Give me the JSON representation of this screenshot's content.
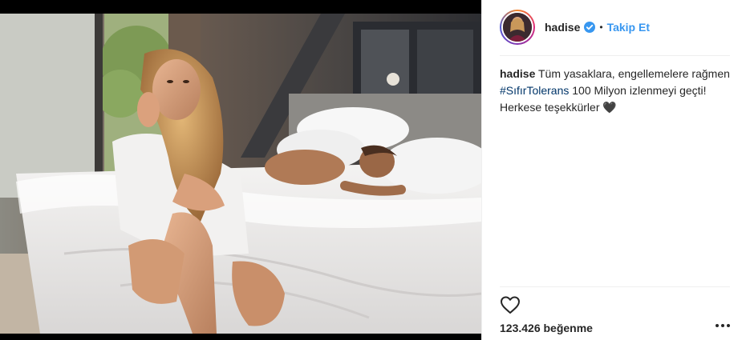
{
  "post": {
    "username": "hadise",
    "follow_label": "Takip Et",
    "separator": "•",
    "caption": {
      "user": "hadise",
      "text_before": " Tüm yasaklara, engellemelere rağmen ",
      "hashtag": "#SıfırTolerans",
      "text_after": " 100 Milyon izlenmeyi geçti! Herkese teşekkürler ",
      "emoji": "🖤"
    },
    "likes": "123.426 beğenme",
    "icons": {
      "verified": "verified-badge-icon",
      "like": "heart-outline-icon",
      "more": "more-options-icon"
    },
    "colors": {
      "link": "#3897f0",
      "hashtag": "#003569",
      "text": "#262626",
      "divider": "#efefef"
    }
  }
}
